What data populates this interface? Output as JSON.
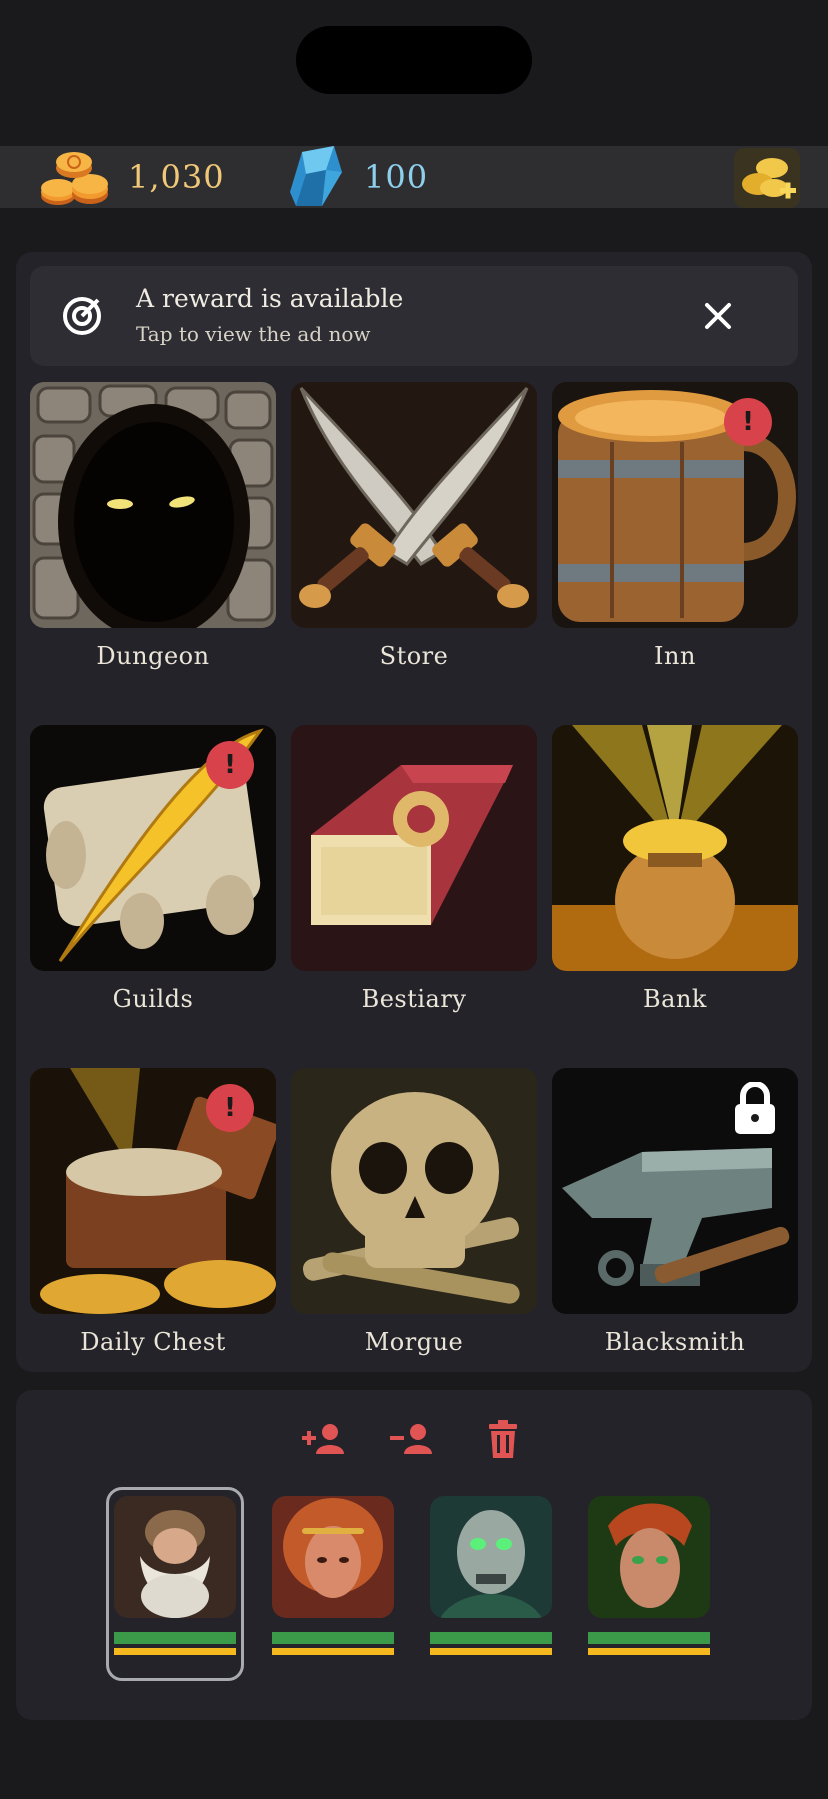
{
  "currency": {
    "gold": "1,030",
    "gems": "100",
    "gold_icon": "gold-coins-icon",
    "gem_icon": "blue-crystal-icon",
    "buy_icon": "buy-gold-icon"
  },
  "reward_banner": {
    "title": "A reward is available",
    "subtitle": "Tap to view the ad now",
    "icon": "target-icon",
    "close_icon": "close-icon"
  },
  "buildings": [
    {
      "label": "Dungeon",
      "badge": false,
      "locked": false
    },
    {
      "label": "Store",
      "badge": false,
      "locked": false
    },
    {
      "label": "Inn",
      "badge": true,
      "locked": false
    },
    {
      "label": "Guilds",
      "badge": true,
      "locked": false
    },
    {
      "label": "Bestiary",
      "badge": false,
      "locked": false
    },
    {
      "label": "Bank",
      "badge": false,
      "locked": false
    },
    {
      "label": "Daily Chest",
      "badge": true,
      "locked": false
    },
    {
      "label": "Morgue",
      "badge": false,
      "locked": false
    },
    {
      "label": "Blacksmith",
      "badge": false,
      "locked": true
    }
  ],
  "badge_text": "!",
  "party": {
    "actions": [
      "add-member-icon",
      "remove-member-icon",
      "trash-icon"
    ],
    "members": [
      {
        "name": "dwarf-portrait",
        "hp": 1.0,
        "xp": 1.0,
        "selected": true
      },
      {
        "name": "elf-woman-portrait",
        "hp": 1.0,
        "xp": 1.0,
        "selected": false
      },
      {
        "name": "undead-portrait",
        "hp": 1.0,
        "xp": 1.0,
        "selected": false
      },
      {
        "name": "elf-ranger-portrait",
        "hp": 1.0,
        "xp": 1.0,
        "selected": false
      }
    ]
  },
  "colors": {
    "background": "#1a1a1d",
    "panel": "#242329",
    "badge": "#d8424a",
    "action": "#e05454",
    "hp": "#3a9a4a",
    "xp": "#f5b81e"
  }
}
